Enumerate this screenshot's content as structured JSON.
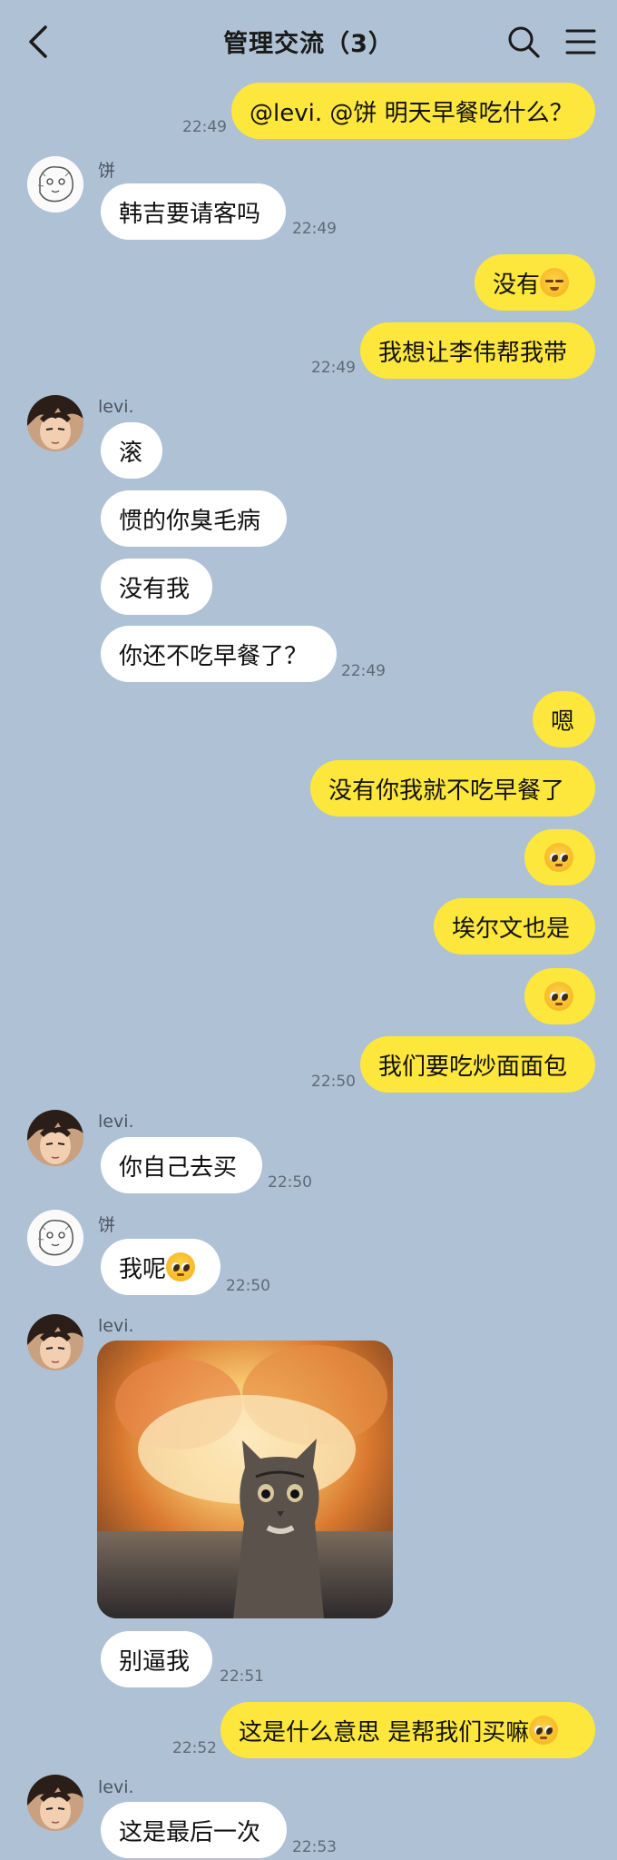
{
  "header": {
    "title": "管理交流（3）",
    "back_icon": "back-arrow-icon",
    "search_icon": "search-icon",
    "menu_icon": "menu-icon"
  },
  "messages": [
    {
      "from": "me",
      "text": "@levi. @饼 明天早餐吃什么？",
      "time": "22:49"
    },
    {
      "from": "饼",
      "sender": "饼",
      "text": "韩吉要请客吗",
      "time": "22:49"
    },
    {
      "from": "me",
      "text": "没有",
      "emoji": "relieved-face",
      "time": ""
    },
    {
      "from": "me",
      "text": "我想让李伟帮我带",
      "time": "22:49"
    },
    {
      "from": "levi",
      "sender": "levi.",
      "text": "滚"
    },
    {
      "from": "levi",
      "text": "惯的你臭毛病"
    },
    {
      "from": "levi",
      "text": "没有我"
    },
    {
      "from": "levi",
      "text": "你还不吃早餐了？",
      "time": "22:49"
    },
    {
      "from": "me",
      "text": "嗯"
    },
    {
      "from": "me",
      "text": "没有你我就不吃早餐了"
    },
    {
      "from": "me",
      "text": "",
      "emoji": "pleading-face"
    },
    {
      "from": "me",
      "text": "埃尔文也是"
    },
    {
      "from": "me",
      "text": "",
      "emoji": "pleading-face"
    },
    {
      "from": "me",
      "text": "我们要吃炒面面包",
      "time": "22:50"
    },
    {
      "from": "levi",
      "sender": "levi.",
      "text": "你自己去买",
      "time": "22:50"
    },
    {
      "from": "饼",
      "sender": "饼",
      "text": "我呢",
      "emoji": "pleading-face",
      "time": "22:50"
    },
    {
      "from": "levi",
      "sender": "levi.",
      "image": "cat-explosion-meme"
    },
    {
      "from": "levi",
      "text": "别逼我",
      "time": "22:51"
    },
    {
      "from": "me",
      "text": "这是什么意思 是帮我们买嘛",
      "emoji": "pleading-face",
      "time": "22:52"
    },
    {
      "from": "levi",
      "sender": "levi.",
      "text": "这是最后一次",
      "time": "22:53"
    }
  ],
  "colors": {
    "background": "#AFC1D4",
    "my_bubble": "#FDE73C",
    "other_bubble": "#FFFFFF"
  }
}
